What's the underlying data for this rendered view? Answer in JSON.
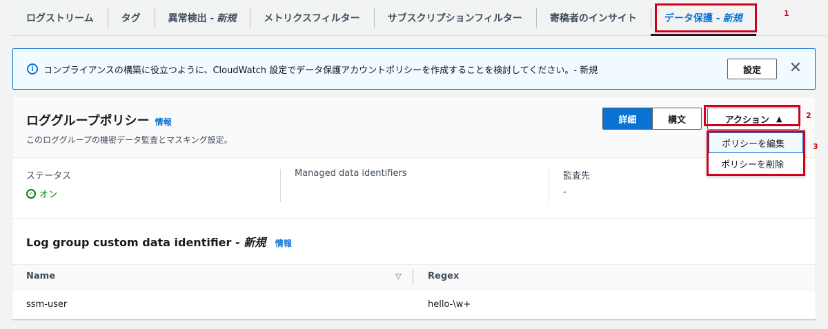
{
  "tabs": [
    {
      "label": "ログストリーム",
      "suffix": ""
    },
    {
      "label": "タグ",
      "suffix": ""
    },
    {
      "label": "異常検出 -",
      "suffix": "新規"
    },
    {
      "label": "メトリクスフィルター",
      "suffix": ""
    },
    {
      "label": "サブスクリプションフィルター",
      "suffix": ""
    },
    {
      "label": "寄稿者のインサイト",
      "suffix": ""
    },
    {
      "label": "データ保護 -",
      "suffix": "新規"
    }
  ],
  "annotations": {
    "n1": "1",
    "n2": "2",
    "n3": "3"
  },
  "banner": {
    "message": "コンプライアンスの構築に役立つように、CloudWatch 設定でデータ保護アカウントポリシーを作成することを検討してください。- 新規",
    "button": "設定"
  },
  "panel": {
    "title": "ロググループポリシー",
    "info": "情報",
    "description": "このロググループの機密データ監査とマスキング設定。",
    "seg_detail": "詳細",
    "seg_syntax": "構文",
    "actions": "アクション",
    "menu": [
      "ポリシーを編集",
      "ポリシーを削除"
    ],
    "status_key": "ステータス",
    "status_value": "オン",
    "mdi_key": "Managed data identifiers",
    "audit_key": "監査先",
    "audit_value": "-"
  },
  "custom": {
    "title": "Log group custom data identifier -",
    "title_suffix": "新規",
    "info": "情報",
    "columns": [
      "Name",
      "Regex"
    ],
    "rows": [
      {
        "name": "ssm-user",
        "regex": "hello-\\w+"
      }
    ]
  }
}
